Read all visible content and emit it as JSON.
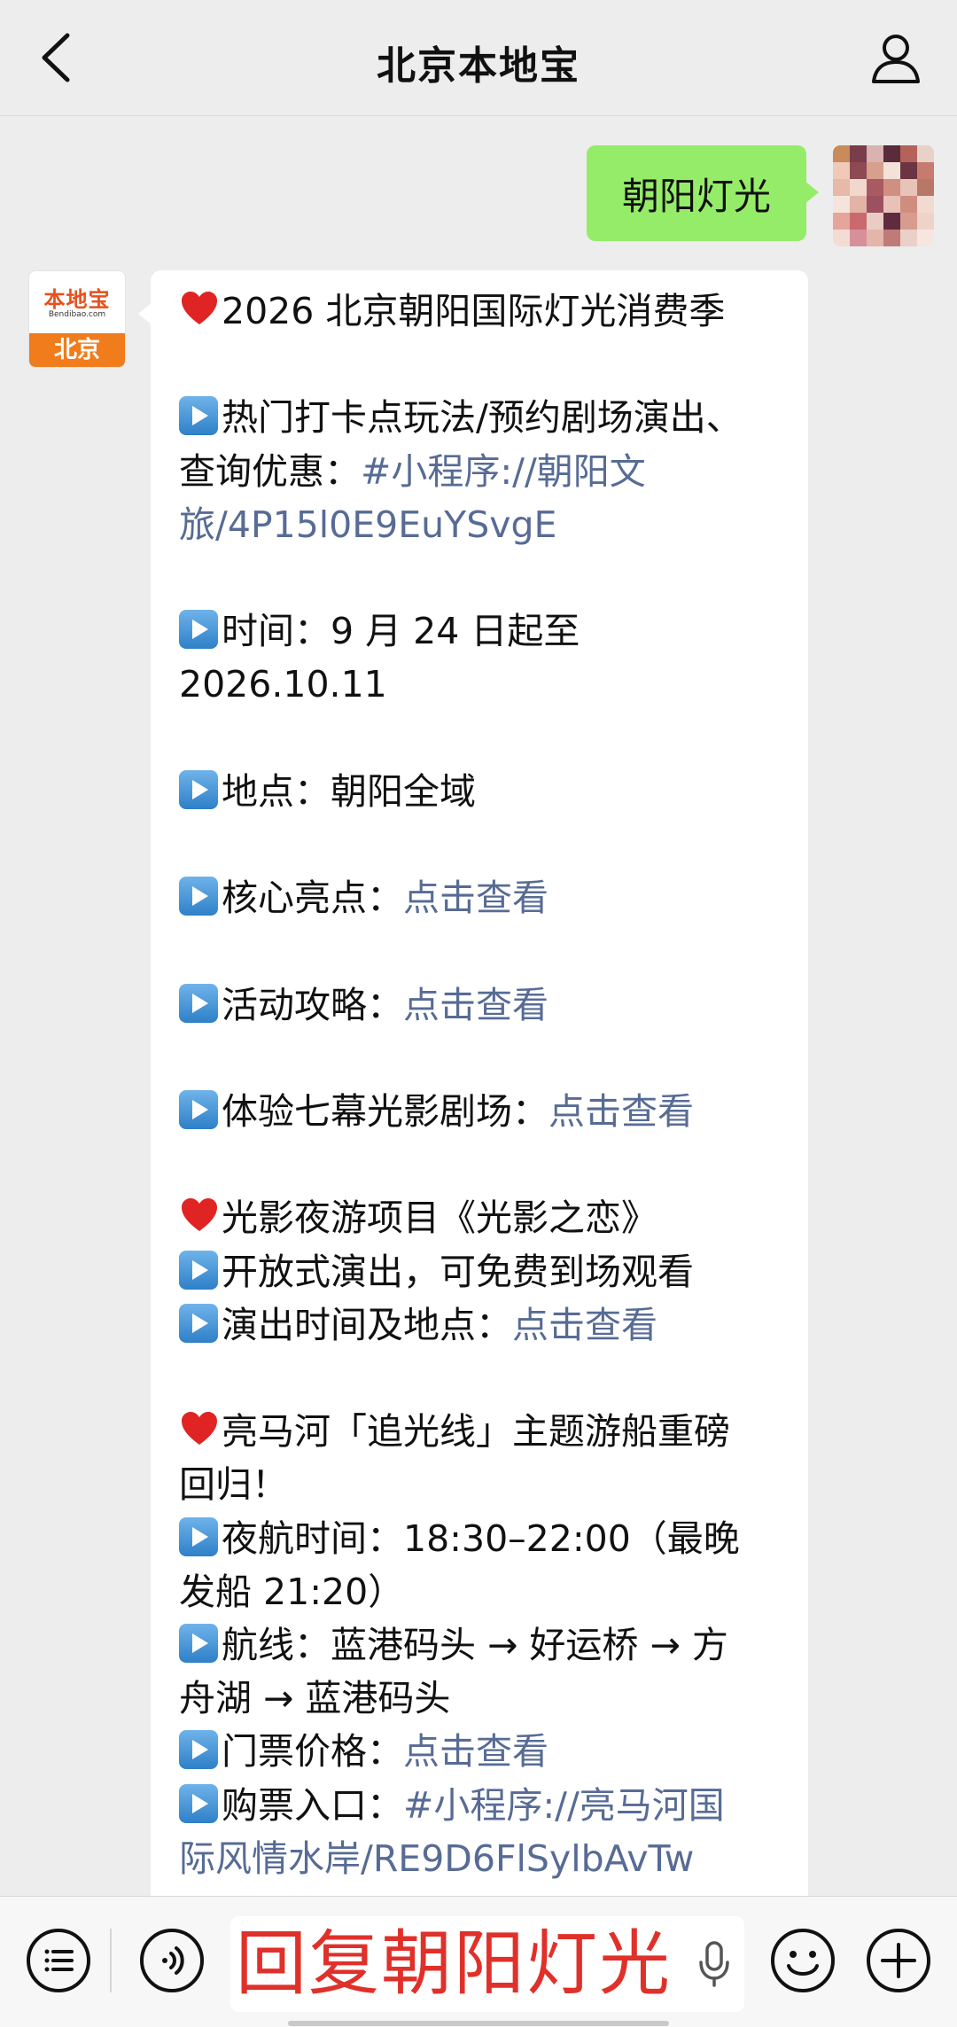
{
  "header": {
    "title": "北京本地宝"
  },
  "outgoing": {
    "text": "朝阳灯光"
  },
  "incoming": {
    "avatar": {
      "logo": "本地宝",
      "domain": "Bendibao.com",
      "city": "北京"
    },
    "lines": [
      {
        "icon": "heart",
        "text": "2026 北京朝阳国际灯光消费季"
      },
      {
        "gap": true
      },
      {
        "icon": "play",
        "text": "热门打卡点玩法/预约剧场演出、"
      },
      {
        "text": "查询优惠：",
        "link": "#小程序://朝阳文"
      },
      {
        "link": "旅/4P15l0E9EuYSvgE"
      },
      {
        "gap": true
      },
      {
        "icon": "play",
        "text": "时间：9 月 24 日起至"
      },
      {
        "text": "2026.10.11"
      },
      {
        "gap": true
      },
      {
        "icon": "play",
        "text": "地点：朝阳全域"
      },
      {
        "gap": true
      },
      {
        "icon": "play",
        "text": "核心亮点：",
        "link": "点击查看"
      },
      {
        "gap": true
      },
      {
        "icon": "play",
        "text": "活动攻略：",
        "link": "点击查看"
      },
      {
        "gap": true
      },
      {
        "icon": "play",
        "text": "体验七幕光影剧场：",
        "link": "点击查看"
      },
      {
        "gap": true
      },
      {
        "icon": "heart",
        "text": "光影夜游项目《光影之恋》"
      },
      {
        "icon": "play",
        "text": "开放式演出，可免费到场观看"
      },
      {
        "icon": "play",
        "text": "演出时间及地点：",
        "link": "点击查看"
      },
      {
        "gap": true
      },
      {
        "icon": "heart",
        "text": "亮马河「追光线」主题游船重磅"
      },
      {
        "text": "回归！"
      },
      {
        "icon": "play",
        "text": "夜航时间：18:30–22:00（最晚"
      },
      {
        "text": "发船 21:20）"
      },
      {
        "icon": "play",
        "text": "航线：蓝港码头 → 好运桥 → 方"
      },
      {
        "text": "舟湖 → 蓝港码头"
      },
      {
        "icon": "play",
        "text": "门票价格：",
        "link": "点击查看"
      },
      {
        "icon": "play",
        "text": "购票入口：",
        "link": "#小程序://亮马河国"
      },
      {
        "link": "际风情水岸/RE9D6FlSylbAvTw"
      }
    ]
  },
  "input": {
    "text": "回复朝阳灯光"
  },
  "colors": {
    "outgoing_bubble": "#95ec69",
    "link": "#576b95",
    "reply_text": "#e0302a",
    "background": "#ededed"
  }
}
